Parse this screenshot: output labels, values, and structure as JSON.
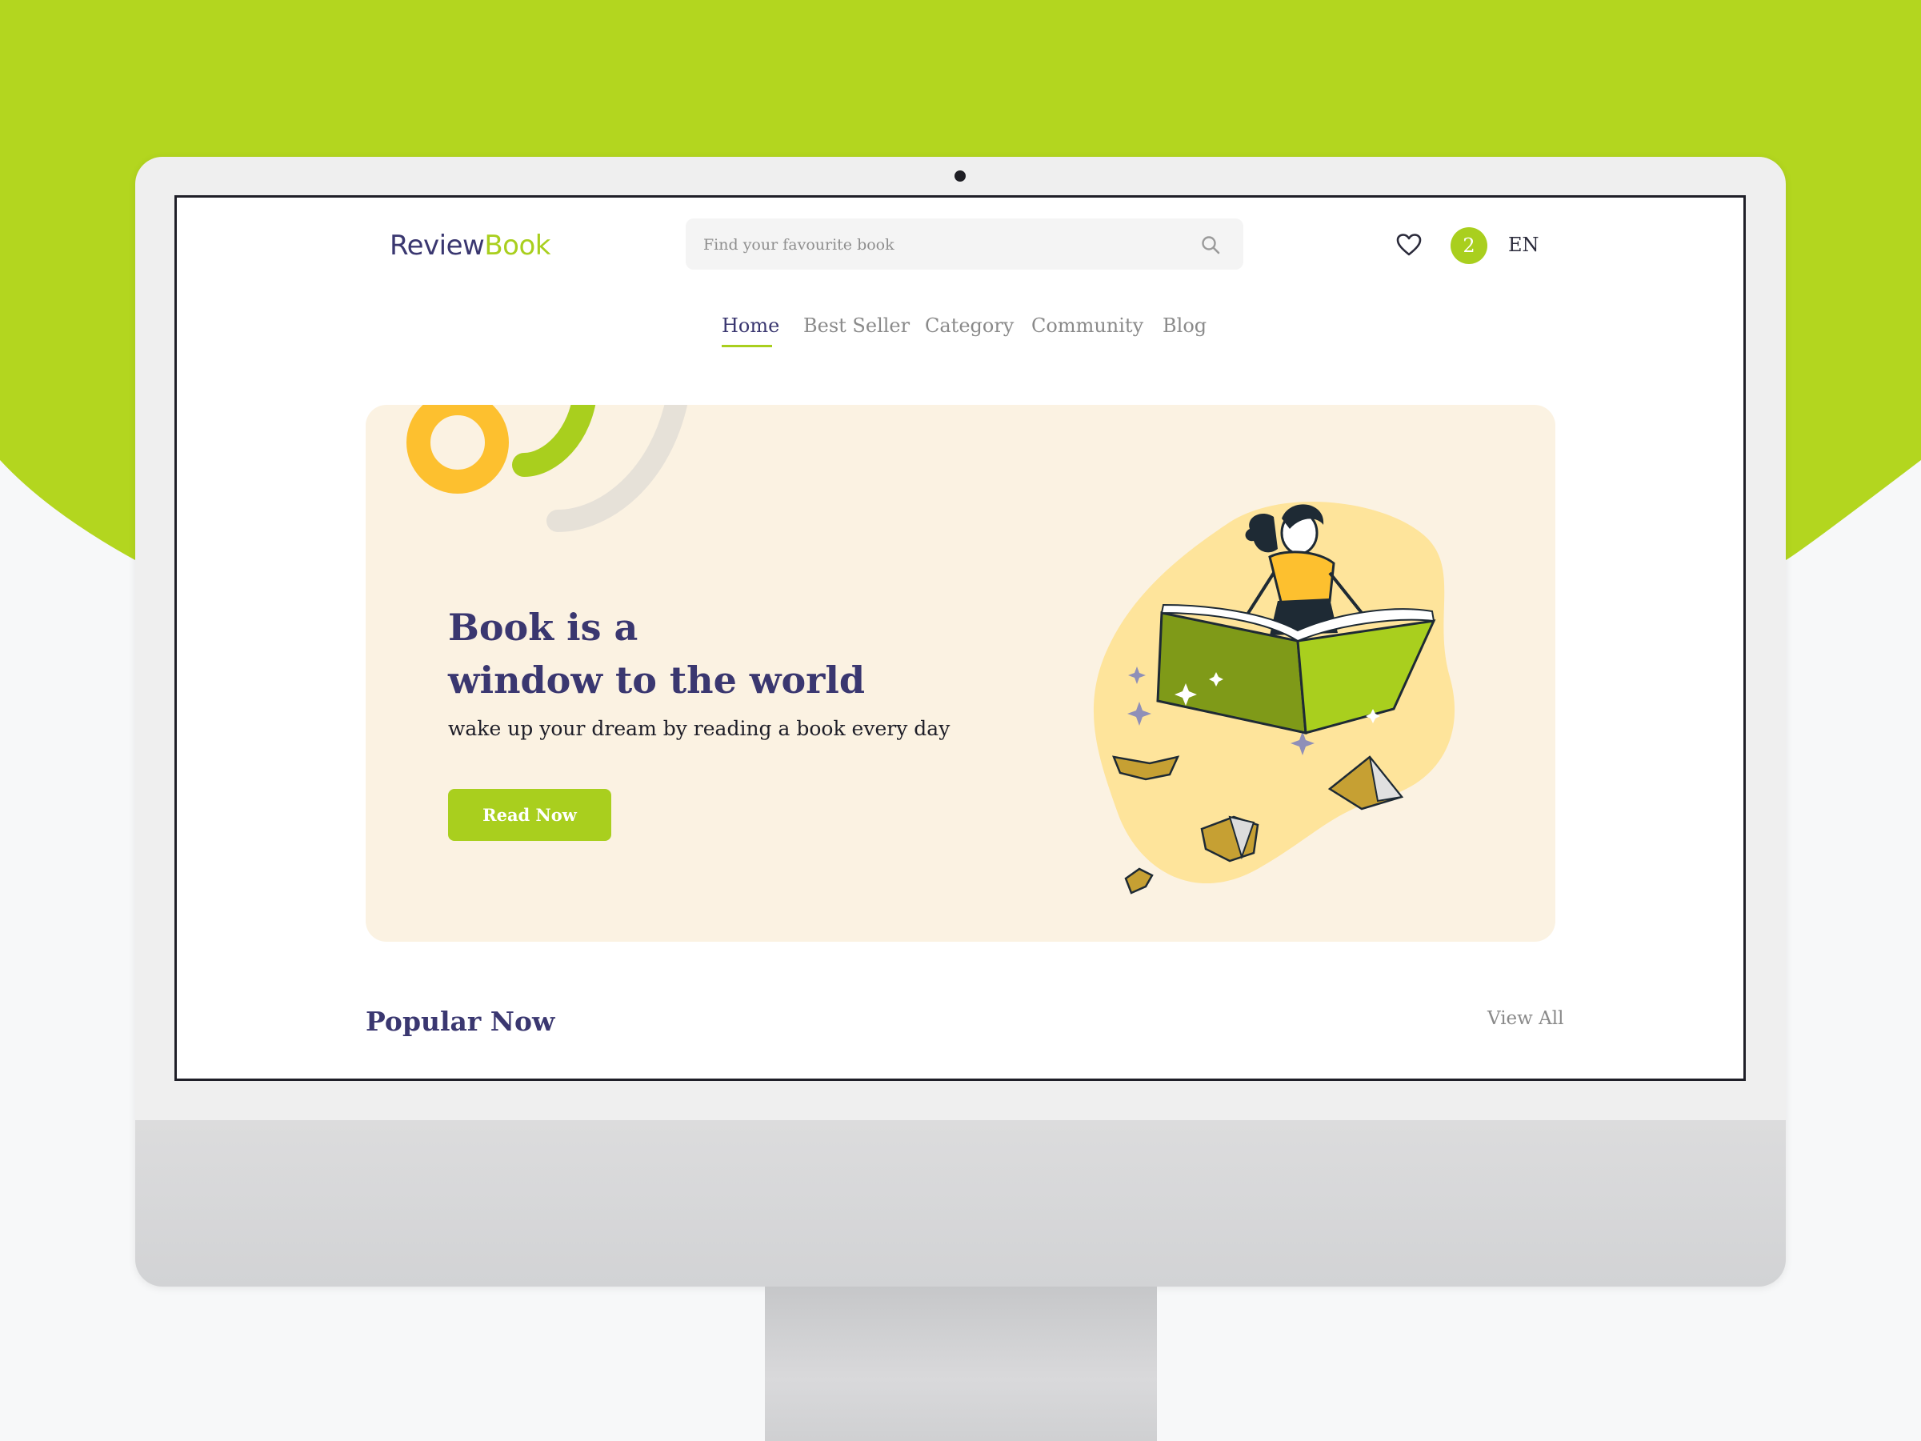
{
  "brand": {
    "logo_part1": "Review",
    "logo_part2": "Book"
  },
  "search": {
    "placeholder": "Find your favourite book",
    "icon": "search-icon"
  },
  "header": {
    "wishlist_icon": "heart-icon",
    "cart_count": "2",
    "language": "EN"
  },
  "nav": {
    "items": [
      {
        "label": "Home",
        "active": true
      },
      {
        "label": "Best Seller",
        "active": false
      },
      {
        "label": "Category",
        "active": false
      },
      {
        "label": "Community",
        "active": false
      },
      {
        "label": "Blog",
        "active": false
      }
    ]
  },
  "hero": {
    "title_line1": "Book is a",
    "title_line2": "window to the world",
    "subtitle": "wake up your dream by reading a book every day",
    "cta_label": "Read Now"
  },
  "popular": {
    "title": "Popular Now",
    "view_all": "View All"
  },
  "colors": {
    "accent": "#a9cf1e",
    "brand_dark": "#3a3770",
    "hero_bg": "#fbf2e2",
    "yellow": "#fdc02f",
    "page_green": "#b3d61f"
  }
}
